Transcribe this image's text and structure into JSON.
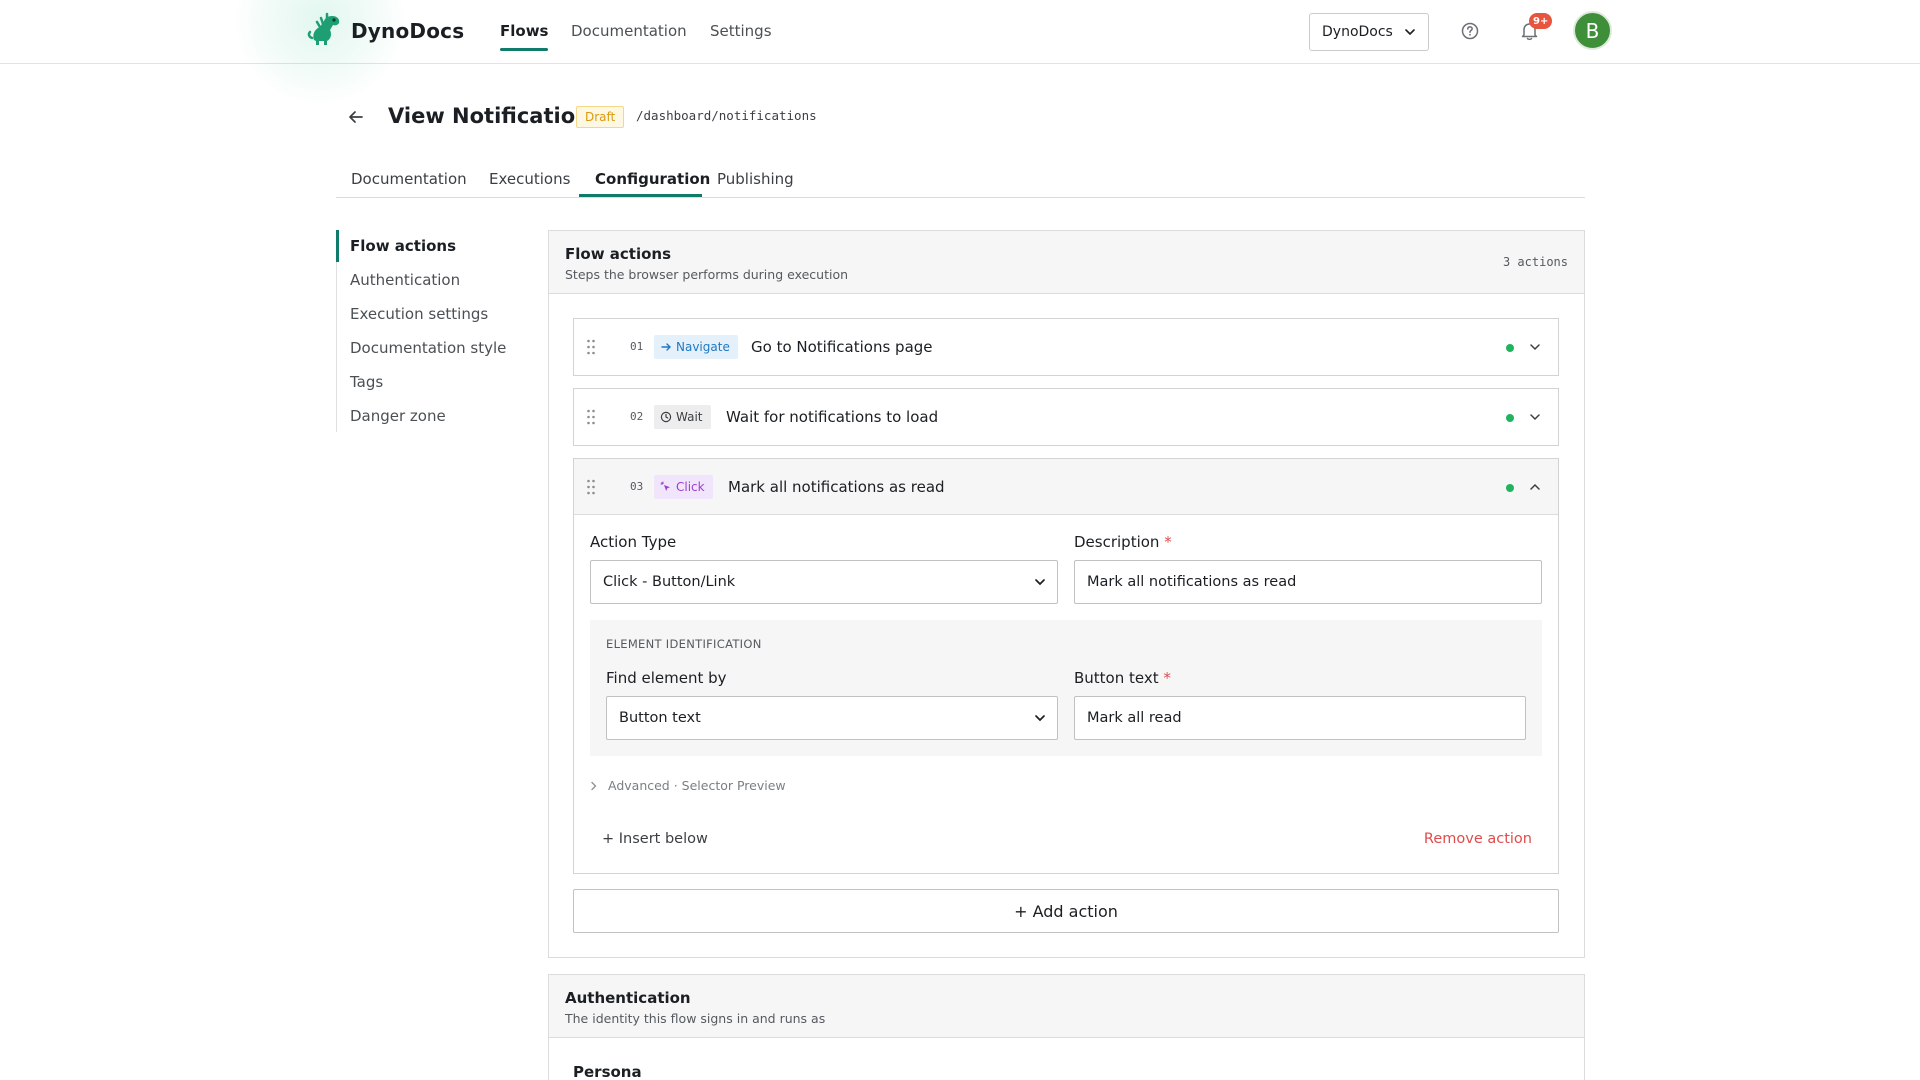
{
  "brand": {
    "name": "DynoDocs"
  },
  "nav": {
    "items": [
      "Flows",
      "Documentation",
      "Settings"
    ],
    "active": "Flows"
  },
  "workspace": {
    "selected": "DynoDocs"
  },
  "notifications": {
    "count": "9+"
  },
  "user": {
    "initial": "B"
  },
  "colors": {
    "accent": "#0f7b68",
    "status_ok": "#22b35e",
    "danger": "#e24b4b",
    "draft": "#d99a10"
  },
  "page": {
    "title": "View Notifications",
    "status": "Draft",
    "path": "/dashboard/notifications"
  },
  "tabs": {
    "items": [
      "Documentation",
      "Executions",
      "Configuration",
      "Publishing"
    ],
    "active": "Configuration"
  },
  "sidenav": {
    "items": [
      "Flow actions",
      "Authentication",
      "Execution settings",
      "Documentation style",
      "Tags",
      "Danger zone"
    ],
    "active": "Flow actions"
  },
  "flow_actions": {
    "title": "Flow actions",
    "subtitle": "Steps the browser performs during execution",
    "count": "3 actions",
    "actions": [
      {
        "number": "01",
        "type": "Navigate",
        "type_icon": "arrow-right-icon",
        "title": "Go to Notifications page",
        "status": "ok",
        "expanded": false
      },
      {
        "number": "02",
        "type": "Wait",
        "type_icon": "clock-icon",
        "title": "Wait for notifications to load",
        "status": "ok",
        "expanded": false
      },
      {
        "number": "03",
        "type": "Click",
        "type_icon": "cursor-click-icon",
        "title": "Mark all notifications as read",
        "status": "ok",
        "expanded": true
      }
    ],
    "editor": {
      "action_type_label": "Action Type",
      "action_type_value": "Click - Button/Link",
      "description_label": "Description",
      "description_value": "Mark all notifications as read",
      "required_mark": "*",
      "element_section_title": "ELEMENT IDENTIFICATION",
      "find_by_label": "Find element by",
      "find_by_value": "Button text",
      "button_text_label": "Button text",
      "button_text_value": "Mark all read",
      "advanced_label": "Advanced · Selector Preview",
      "insert_below": "+ Insert below",
      "remove_action": "Remove action"
    },
    "add_action": "+ Add action"
  },
  "authentication": {
    "title": "Authentication",
    "subtitle": "The identity this flow signs in and runs as",
    "persona_label": "Persona"
  }
}
